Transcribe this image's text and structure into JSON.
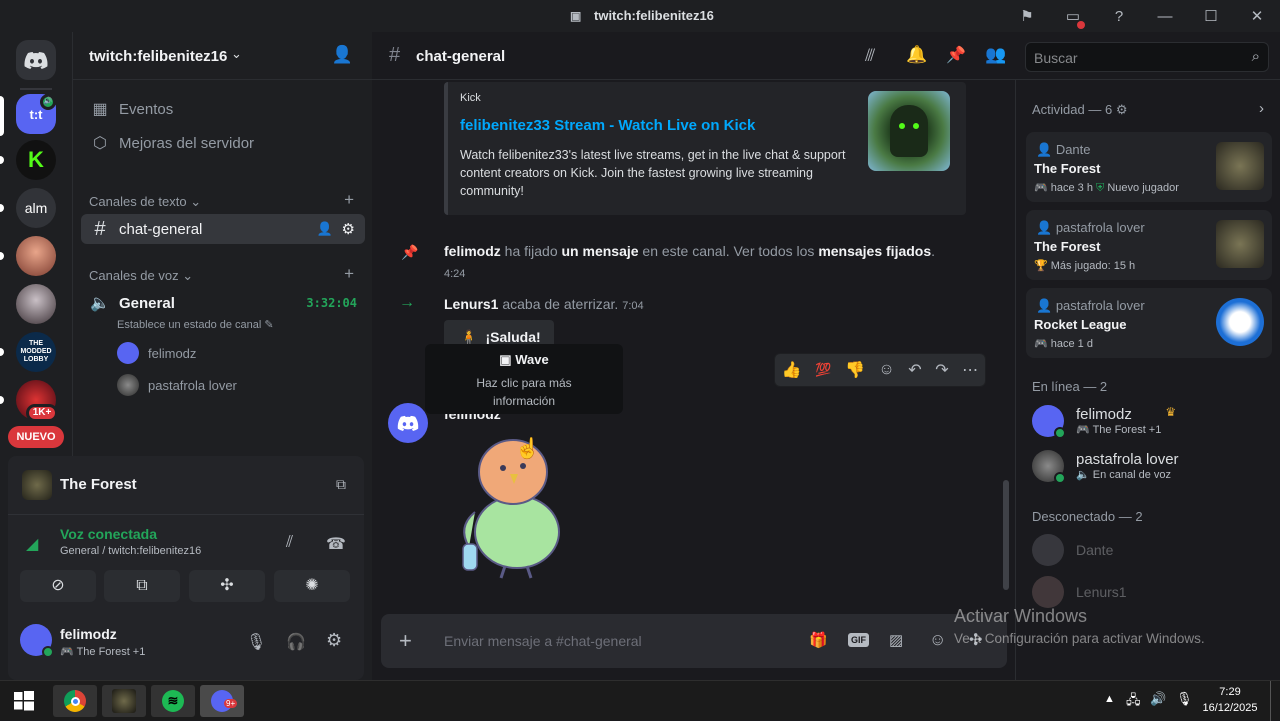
{
  "window": {
    "title": "twitch:felibenitez16"
  },
  "server": {
    "name": "twitch:felibenitez16",
    "events": "Eventos",
    "boosts": "Mejoras del servidor",
    "text_category": "Canales de texto",
    "voice_category": "Canales de voz",
    "text_channel": "chat-general",
    "voice_channel": "General",
    "voice_timer": "3:32:04",
    "voice_status_hint": "Establece un estado de canal",
    "voice_users": [
      "felimodz",
      "pastafrola lover"
    ]
  },
  "guilds": {
    "alm": "alm",
    "badge_count": "1K+",
    "new_label": "NUEVO",
    "modded_lobby": "THE MODDED LOBBY"
  },
  "panel": {
    "game": "The Forest",
    "voice_connected": "Voz conectada",
    "voice_location": "General / twitch:felibenitez16",
    "username": "felimodz",
    "user_status": "The Forest +1"
  },
  "channel": {
    "name": "chat-general",
    "search_placeholder": "Buscar",
    "composer_placeholder": "Enviar mensaje a #chat-general"
  },
  "embed": {
    "provider": "Kick",
    "title": "felibenitez33 Stream - Watch Live on Kick",
    "description": "Watch felibenitez33's latest live streams, get in the live chat & support content creators on Kick. Join the fastest growing live streaming community!"
  },
  "messages": {
    "pin_user": "felimodz",
    "pin_text1": " ha fijado ",
    "pin_bold1": "un mensaje",
    "pin_text2": " en este canal. Ver todos los ",
    "pin_bold2": "mensajes fijados",
    "pin_text3": ".",
    "pin_time": "4:24",
    "join_user": "Lenurs1",
    "join_text": " acaba de aterrizar.",
    "join_time": "7:04",
    "wave_button": "¡Saluda!",
    "sticker_author": "felimodz",
    "tooltip_title": "Wave",
    "tooltip_text": "Haz clic para más información"
  },
  "members": {
    "activity_header": "Actividad — 6",
    "activities": [
      {
        "who": "Dante",
        "game": "The Forest",
        "time": "hace 3 h",
        "extra": "Nuevo jugador"
      },
      {
        "who": "pastafrola lover",
        "game": "The Forest",
        "time": "Más jugado: 15 h",
        "extra": ""
      },
      {
        "who": "pastafrola lover",
        "game": "Rocket League",
        "time": "hace 1 d",
        "extra": ""
      }
    ],
    "online_header": "En línea — 2",
    "online": [
      {
        "name": "felimodz",
        "status": "The Forest +1"
      },
      {
        "name": "pastafrola lover",
        "status": "En canal de voz"
      }
    ],
    "offline_header": "Desconectado — 2",
    "offline": [
      "Dante",
      "Lenurs1"
    ]
  },
  "watermark": {
    "line1": "Activar Windows",
    "line2": "Ve a Configuración para activar Windows."
  },
  "taskbar": {
    "time": "7:29",
    "date": "16/12/2025"
  },
  "colors": {
    "accent": "#5865f2",
    "green": "#23a55a",
    "link": "#00a8fc",
    "red": "#da373c",
    "kick": "#53fc18"
  }
}
